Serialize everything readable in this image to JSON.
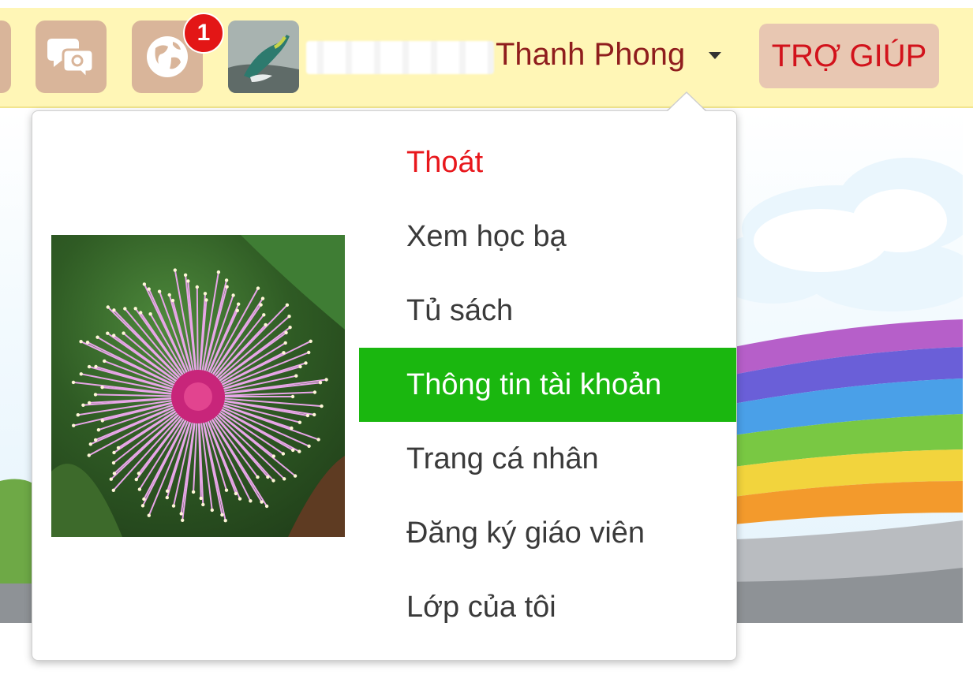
{
  "header": {
    "notification_count": "1",
    "user_name": "Thanh Phong",
    "help_label": "TRỢ GIÚP"
  },
  "menu": {
    "items": [
      {
        "label": "Thoát"
      },
      {
        "label": "Xem học bạ"
      },
      {
        "label": "Tủ sách"
      },
      {
        "label": "Thông tin tài khoản"
      },
      {
        "label": "Trang cá nhân"
      },
      {
        "label": "Đăng ký giáo viên"
      },
      {
        "label": "Lớp của tôi"
      }
    ],
    "active_index": 3
  },
  "colors": {
    "topbar": "#fff6b6",
    "icon_button": "#d9b59a",
    "help_button": "#e8c7b2",
    "help_text": "#d2121b",
    "logout_text": "#e8171c",
    "active_item": "#1ab70f",
    "badge": "#e31616"
  },
  "icons": [
    "chat-bubbles-icon",
    "globe-icon",
    "user-avatar",
    "caret-down-icon",
    "profile-flower-photo"
  ]
}
